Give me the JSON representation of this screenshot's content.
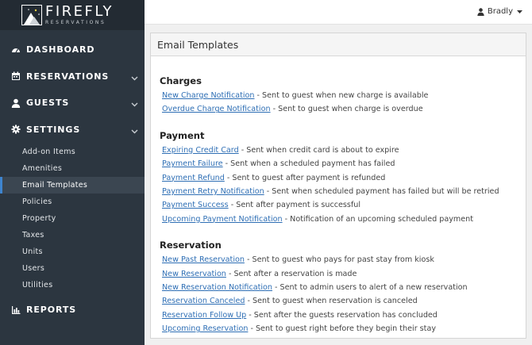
{
  "brand": {
    "name": "FIREFLY",
    "tagline": "RESERVATIONS"
  },
  "user": {
    "name": "Bradly"
  },
  "nav": {
    "dashboard": "DASHBOARD",
    "reservations": "RESERVATIONS",
    "guests": "GUESTS",
    "settings": "SETTINGS",
    "reports": "REPORTS",
    "settings_items": [
      "Add-on Items",
      "Amenities",
      "Email Templates",
      "Policies",
      "Property",
      "Taxes",
      "Units",
      "Users",
      "Utilities"
    ],
    "active_item": "Email Templates"
  },
  "panel": {
    "title": "Email Templates",
    "sections": [
      {
        "title": "Charges",
        "items": [
          {
            "link": "New Charge Notification",
            "desc": " - Sent to guest when new charge is available"
          },
          {
            "link": "Overdue Charge Notification",
            "desc": " - Sent to guest when charge is overdue"
          }
        ]
      },
      {
        "title": "Payment",
        "items": [
          {
            "link": "Expiring Credit Card",
            "desc": " - Sent when credit card is about to expire"
          },
          {
            "link": "Payment Failure",
            "desc": " - Sent when a scheduled payment has failed"
          },
          {
            "link": "Payment Refund",
            "desc": " - Sent to guest after payment is refunded"
          },
          {
            "link": "Payment Retry Notification",
            "desc": " - Sent when scheduled payment has failed but will be retried"
          },
          {
            "link": "Payment Success",
            "desc": " - Sent after payment is successful"
          },
          {
            "link": "Upcoming Payment Notification",
            "desc": " - Notification of an upcoming scheduled payment"
          }
        ]
      },
      {
        "title": "Reservation",
        "items": [
          {
            "link": "New Past Reservation",
            "desc": " - Sent to guest who pays for past stay from kiosk"
          },
          {
            "link": "New Reservation",
            "desc": " - Sent after a reservation is made"
          },
          {
            "link": "New Reservation Notification",
            "desc": " - Sent to admin users to alert of a new reservation"
          },
          {
            "link": "Reservation Canceled",
            "desc": " - Sent to guest when reservation is canceled"
          },
          {
            "link": "Reservation Follow Up",
            "desc": " - Sent after the guests reservation has concluded"
          },
          {
            "link": "Upcoming Reservation",
            "desc": " - Sent to guest right before they begin their stay"
          }
        ]
      }
    ]
  },
  "colors": {
    "sidebar": "#2c3640",
    "active_accent": "#3e85cf",
    "link": "#2f6fb5"
  }
}
